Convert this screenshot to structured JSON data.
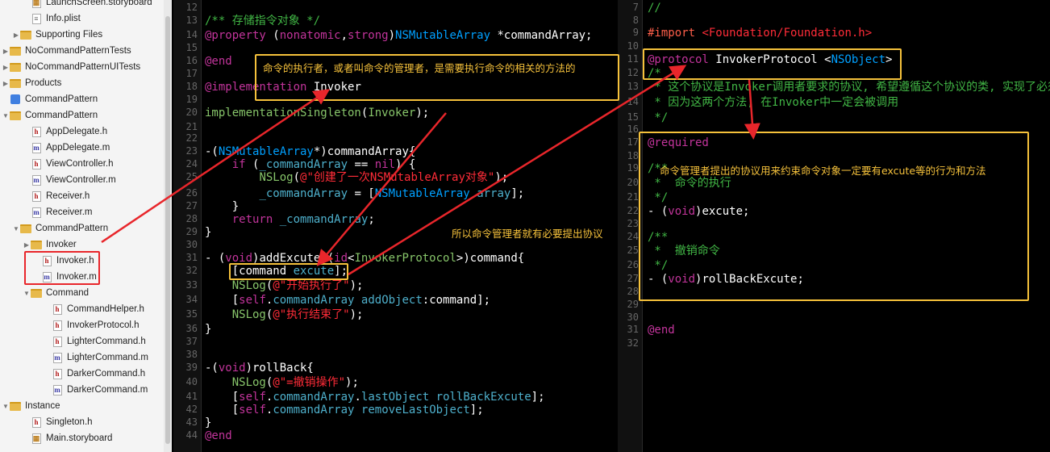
{
  "navigator": {
    "rows": [
      {
        "label": "LaunchScreen.storyboard",
        "type": "storyboard",
        "indent": 2,
        "disclosure": ""
      },
      {
        "label": "Info.plist",
        "type": "plist",
        "indent": 2,
        "disclosure": ""
      },
      {
        "label": "Supporting Files",
        "type": "folder",
        "indent": 1,
        "disclosure": "▶"
      },
      {
        "label": "NoCommandPatternTests",
        "type": "folder",
        "indent": 0,
        "disclosure": "▶"
      },
      {
        "label": "NoCommandPatternUITests",
        "type": "folder",
        "indent": 0,
        "disclosure": "▶"
      },
      {
        "label": "Products",
        "type": "folder",
        "indent": 0,
        "disclosure": "▶"
      },
      {
        "label": "CommandPattern",
        "type": "project",
        "indent": 0,
        "disclosure": ""
      },
      {
        "label": "CommandPattern",
        "type": "folder",
        "indent": 0,
        "disclosure": "▼"
      },
      {
        "label": "AppDelegate.h",
        "type": "h",
        "indent": 2,
        "disclosure": ""
      },
      {
        "label": "AppDelegate.m",
        "type": "m",
        "indent": 2,
        "disclosure": ""
      },
      {
        "label": "ViewController.h",
        "type": "h",
        "indent": 2,
        "disclosure": ""
      },
      {
        "label": "ViewController.m",
        "type": "m",
        "indent": 2,
        "disclosure": ""
      },
      {
        "label": "Receiver.h",
        "type": "h",
        "indent": 2,
        "disclosure": ""
      },
      {
        "label": "Receiver.m",
        "type": "m",
        "indent": 2,
        "disclosure": ""
      },
      {
        "label": "CommandPattern",
        "type": "folder",
        "indent": 1,
        "disclosure": "▼"
      },
      {
        "label": "Invoker",
        "type": "folder",
        "indent": 2,
        "disclosure": "▶"
      },
      {
        "label": "Invoker.h",
        "type": "h",
        "indent": 3,
        "disclosure": ""
      },
      {
        "label": "Invoker.m",
        "type": "m",
        "indent": 3,
        "disclosure": ""
      },
      {
        "label": "Command",
        "type": "folder",
        "indent": 2,
        "disclosure": "▼"
      },
      {
        "label": "CommandHelper.h",
        "type": "h",
        "indent": 4,
        "disclosure": ""
      },
      {
        "label": "InvokerProtocol.h",
        "type": "h",
        "indent": 4,
        "disclosure": ""
      },
      {
        "label": "LighterCommand.h",
        "type": "h",
        "indent": 4,
        "disclosure": ""
      },
      {
        "label": "LighterCommand.m",
        "type": "m",
        "indent": 4,
        "disclosure": ""
      },
      {
        "label": "DarkerCommand.h",
        "type": "h",
        "indent": 4,
        "disclosure": ""
      },
      {
        "label": "DarkerCommand.m",
        "type": "m",
        "indent": 4,
        "disclosure": ""
      },
      {
        "label": "Instance",
        "type": "folder",
        "indent": 0,
        "disclosure": "▼"
      },
      {
        "label": "Singleton.h",
        "type": "h",
        "indent": 2,
        "disclosure": ""
      },
      {
        "label": "Main.storyboard",
        "type": "storyboard",
        "indent": 2,
        "disclosure": ""
      }
    ]
  },
  "editor_left": {
    "line_numbers": [
      "12",
      "13",
      "14",
      "15",
      "16",
      "17",
      "18",
      "19",
      "20",
      "21",
      "22",
      "23",
      "24",
      "25",
      "26",
      "27",
      "28",
      "29",
      "30",
      "31",
      "32",
      "33",
      "34",
      "35",
      "36",
      "37",
      "38",
      "39",
      "40",
      "41",
      "42",
      "43",
      "44"
    ]
  },
  "editor_right": {
    "line_numbers": [
      "7",
      "8",
      "9",
      "10",
      "11",
      "12",
      "13",
      "14",
      "15",
      "16",
      "17",
      "18",
      "19",
      "20",
      "21",
      "22",
      "23",
      "24",
      "25",
      "26",
      "27",
      "28",
      "29",
      "30",
      "31",
      "32"
    ],
    "line_number_tops": [
      2,
      22,
      42,
      62,
      82,
      102,
      122,
      142,
      162,
      182,
      202,
      222,
      242,
      262,
      282,
      302,
      322,
      342,
      362,
      382,
      402,
      422
    ]
  },
  "code_left": {
    "l13": [
      "/** 存储指令对象 */"
    ],
    "l14": [
      "@property",
      " (",
      "nonatomic",
      ",",
      "strong",
      ")",
      "NSMutableArray",
      " *commandArray;"
    ],
    "l16": [
      "@end"
    ],
    "l18": [
      "@implementation",
      " Invoker"
    ],
    "l20": [
      "implementationSingleton",
      "(",
      "Invoker",
      ");"
    ],
    "l23": [
      "-(",
      "NSMutableArray",
      "*)commandArray{"
    ],
    "l24": [
      "    ",
      "if",
      " (",
      "_commandArray",
      " == ",
      "nil",
      ") {"
    ],
    "l25": [
      "        ",
      "NSLog",
      "(",
      "@\"创建了一次NSMutableArray对象\"",
      ");"
    ],
    "l26": [
      "        ",
      "_commandArray",
      " = [",
      "NSMutableArray",
      " ",
      "array",
      "];"
    ],
    "l27": [
      "    }"
    ],
    "l28": [
      "    ",
      "return",
      " ",
      "_commandArray",
      ";"
    ],
    "l29": [
      "}"
    ],
    "l31": [
      "- (",
      "void",
      ")addExcute:(",
      "id",
      "<",
      "InvokerProtocol",
      ">)command{"
    ],
    "l32": [
      "    [command ",
      "excute",
      "];"
    ],
    "l33": [
      "    ",
      "NSLog",
      "(",
      "@\"开始执行了\"",
      ");"
    ],
    "l34": [
      "    [",
      "self",
      ".",
      "commandArray",
      " ",
      "addObject",
      ":command];"
    ],
    "l35": [
      "    ",
      "NSLog",
      "(",
      "@\"执行结束了\"",
      ");"
    ],
    "l36": [
      "}"
    ],
    "l39": [
      "-(",
      "void",
      ")rollBack{"
    ],
    "l40": [
      "    ",
      "NSLog",
      "(",
      "@\"=撤销操作\"",
      ");"
    ],
    "l41": [
      "    [",
      "self",
      ".",
      "commandArray",
      ".",
      "lastObject",
      " ",
      "rollBackExcute",
      "];"
    ],
    "l42": [
      "    [",
      "self",
      ".",
      "commandArray",
      " ",
      "removeLastObject",
      "];"
    ],
    "l43": [
      "}"
    ],
    "l44": [
      "@end"
    ]
  },
  "code_right": {
    "r7": [
      "//"
    ],
    "r9": [
      "#import",
      " <Foundation/Foundation.h>"
    ],
    "r11": [
      "@protocol",
      " InvokerProtocol <",
      "NSObject",
      ">"
    ],
    "r12": [
      "/*"
    ],
    "r13": [
      " * 这个协议是Invoker调用者要求的协议, 希望遵循这个协议的类, 实现了必须"
    ],
    "r14": [
      " * 因为这两个方法, 在Invoker中一定会被调用"
    ],
    "r15": [
      " */"
    ],
    "r17": [
      "@required"
    ],
    "r19": [
      "/**"
    ],
    "r20": [
      " *  命令的执行"
    ],
    "r21": [
      " */"
    ],
    "r22": [
      "- (",
      "void",
      ")excute;"
    ],
    "r24": [
      "/**"
    ],
    "r25": [
      " *  撤销命令"
    ],
    "r26": [
      " */"
    ],
    "r27": [
      "- (",
      "void",
      ")rollBackExcute;"
    ],
    "r31": [
      "@end"
    ]
  },
  "annotations": {
    "note_manager": "命令的执行者，或者叫命令的管理者，是需要执行命令的相关的方法的",
    "note_protocol": "所以命令管理者就有必要提出协议",
    "note_required": "命令管理者提出的协议用来约束命令对象一定要有excute等的行为和方法"
  },
  "colors": {
    "annotation_box": "#f5c13b",
    "arrow": "#e8262b",
    "keyword": "#c2349b",
    "type": "#00a0ff",
    "comment": "#41b645",
    "string": "#ff2c38"
  }
}
